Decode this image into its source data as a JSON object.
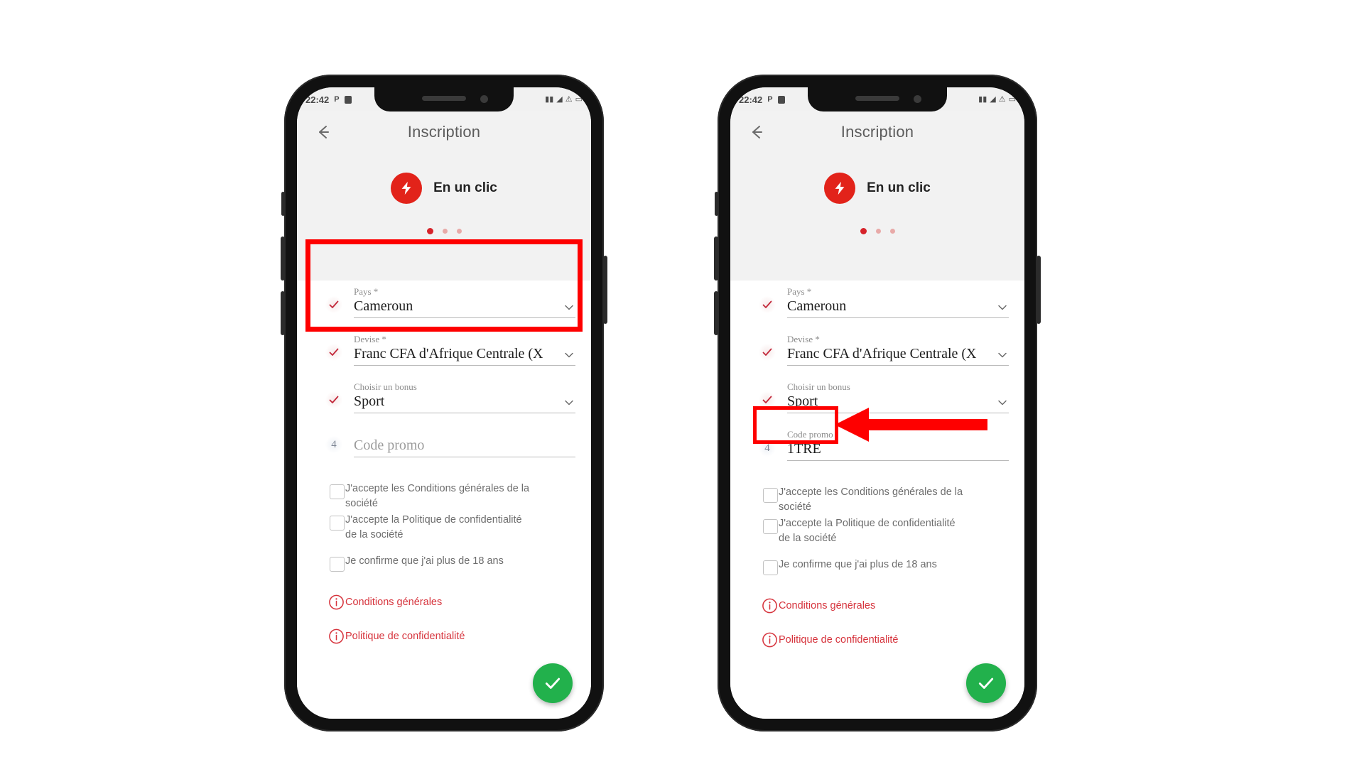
{
  "meta": {
    "colors": {
      "brand_red": "#e2231a",
      "link_red": "#d6333c",
      "annotation_red": "#fe0000",
      "fab_green": "#22b14c",
      "header_bg": "#f2f2f2"
    }
  },
  "status_bar": {
    "time": "22:42",
    "left_icons": [
      "P",
      "battery-save-icon"
    ],
    "right_icons": [
      "dual-sim-icon",
      "wifi-icon",
      "warning-triangle-icon",
      "battery-icon"
    ]
  },
  "header": {
    "back_icon": "back-arrow-icon",
    "title": "Inscription",
    "brand_icon": "lightning-bolt-icon",
    "brand_label": "En un clic",
    "pager": {
      "total": 3,
      "active_index": 0
    }
  },
  "form": {
    "fields": [
      {
        "label": "Pays *",
        "value": "Cameroun",
        "status_icon": "check-icon",
        "status": "valid",
        "control": "dropdown",
        "chevron_icon": "chevron-down-icon"
      },
      {
        "label": "Devise *",
        "value": "Franc CFA d'Afrique Centrale (X",
        "status_icon": "check-icon",
        "status": "valid",
        "control": "dropdown",
        "chevron_icon": "chevron-down-icon"
      },
      {
        "label": "Choisir un bonus",
        "value": "Sport",
        "status_icon": "check-icon",
        "status": "valid",
        "control": "dropdown",
        "chevron_icon": "chevron-down-icon"
      }
    ],
    "promo_field": {
      "label": "Code promo",
      "step_number": "4",
      "placeholder": "Code promo",
      "value_left": "",
      "value_right": "1TRE",
      "control": "text-input"
    },
    "checkboxes": [
      {
        "label": "J'accepte les Conditions générales de la société",
        "checked": false
      },
      {
        "label": "J'accepte la Politique de confidentialité de la société",
        "checked": false
      },
      {
        "label": "Je confirme que j'ai plus de 18 ans",
        "checked": false
      }
    ],
    "links": [
      {
        "icon": "info-circle-icon",
        "label": "Conditions générales"
      },
      {
        "icon": "info-circle-icon",
        "label": "Politique de confidentialité"
      }
    ],
    "submit": {
      "icon": "check-icon",
      "label": ""
    }
  },
  "annotations": {
    "left_highlight": "country-currency-highlight",
    "right_highlight": "promo-code-highlight",
    "right_arrow": "pointer-arrow-left"
  }
}
